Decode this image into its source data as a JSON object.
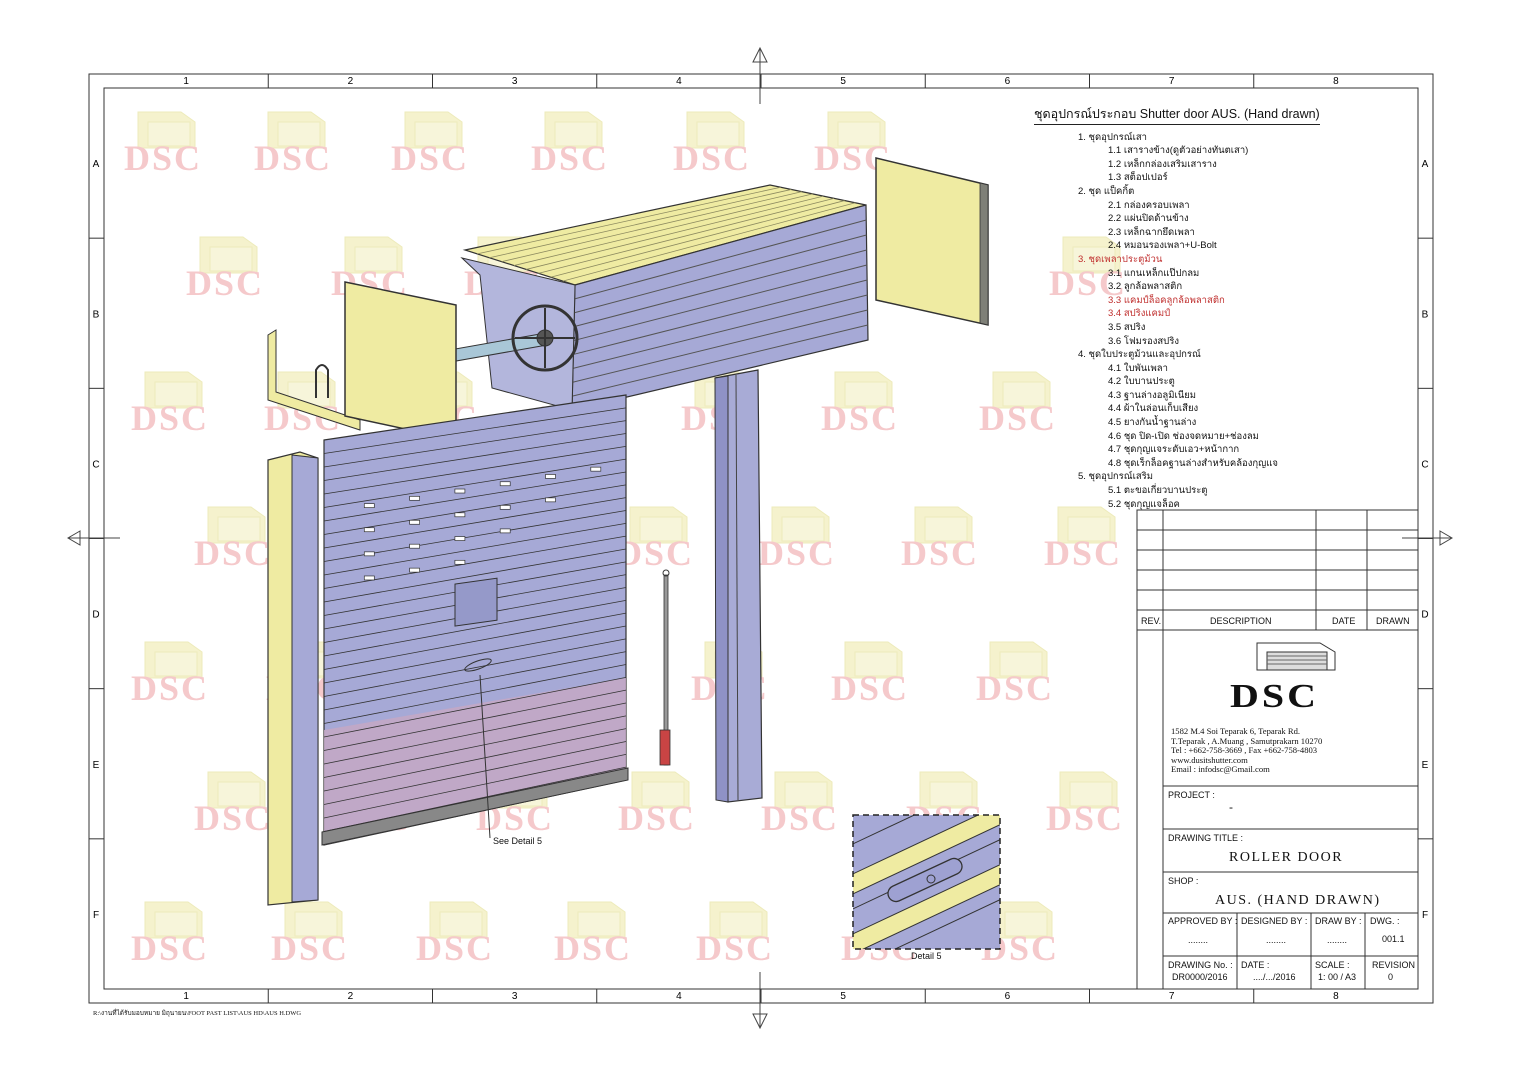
{
  "grid": {
    "columns": [
      "1",
      "2",
      "3",
      "4",
      "5",
      "6",
      "7",
      "8"
    ],
    "rows": [
      "A",
      "B",
      "C",
      "D",
      "E",
      "F"
    ]
  },
  "watermark": {
    "text": "DSC"
  },
  "parts_list": {
    "title": "ชุดอุปกรณ์ประกอบ Shutter door  AUS. (Hand drawn)",
    "items": [
      {
        "text": "1. ชุดอุปกรณ์เสา",
        "level": 0
      },
      {
        "text": "1.1 เสารางข้าง(ดูตัวอย่างทันตเสา)",
        "level": 1
      },
      {
        "text": "1.2 เหล็กกล่องเสริมเสาราง",
        "level": 1
      },
      {
        "text": "1.3 สต็อปเปอร์",
        "level": 1
      },
      {
        "text": "2. ชุด แป็คกิ้ต",
        "level": 0
      },
      {
        "text": "2.1 กล่องครอบเพลา",
        "level": 1
      },
      {
        "text": "2.2 แผ่นปิดด้านข้าง",
        "level": 1
      },
      {
        "text": "2.3 เหล็กฉากยึดเพลา",
        "level": 1
      },
      {
        "text": "2.4 หมอนรองเพลา+U-Bolt",
        "level": 1
      },
      {
        "text": "3. ชุดเพลาประตูม้วน",
        "level": 0,
        "accent": true
      },
      {
        "text": "3.1 แกนเหล็กแป๊ปกลม",
        "level": 1
      },
      {
        "text": "3.2 ลูกล้อพลาสติก",
        "level": 1
      },
      {
        "text": "3.3 แคมป์ล็อคลูกล้อพลาสติก",
        "level": 1,
        "accent": true
      },
      {
        "text": "3.4 สปริงแคมป์",
        "level": 1,
        "accent": true
      },
      {
        "text": "3.5 สปริง",
        "level": 1
      },
      {
        "text": "3.6 โฟมรองสปริง",
        "level": 1
      },
      {
        "text": "4. ชุดใบประตูม้วนและอุปกรณ์",
        "level": 0
      },
      {
        "text": "4.1 ใบพันเพลา",
        "level": 1
      },
      {
        "text": "4.2 ใบบานประตู",
        "level": 1
      },
      {
        "text": "4.3 ฐานล่างอลูมิเนียม",
        "level": 1
      },
      {
        "text": "4.4 ผ้าในล่อนเก็บเสียง",
        "level": 1
      },
      {
        "text": "4.5 ยางกันน้ำฐานล่าง",
        "level": 1
      },
      {
        "text": "4.6 ชุด ปิด-เปิด ช่องจดหมาย+ช่องลม",
        "level": 1
      },
      {
        "text": "4.7 ชุดกุญแจระดับเอว+หน้ากาก",
        "level": 1
      },
      {
        "text": "4.8 ชุดเร็กล็อคฐานล่างสำหรับคล้องกุญแจ",
        "level": 1
      },
      {
        "text": "5. ชุดอุปกรณ์เสริม",
        "level": 0
      },
      {
        "text": "5.1 ตะขอเกี่ยวบานประตู",
        "level": 1
      },
      {
        "text": "5.2 ชุดกุญแจล็อค",
        "level": 1
      }
    ]
  },
  "callouts": {
    "see_detail": "See Detail 5",
    "detail_label": "Detail 5"
  },
  "title_block": {
    "revision_headers": {
      "rev": "REV.",
      "description": "DESCRIPTION",
      "date": "DATE",
      "drawn": "DRAWN"
    },
    "company": {
      "logo_text": "DSC",
      "address_lines": [
        "1582 M.4 Soi Teparak 6, Teparak Rd.",
        "T.Teparak , A.Muang , Samutprakarn 10270",
        "Tel : +662-758-3669 , Fax +662-758-4803",
        "www.dusitshutter.com",
        "Email : infodsc@Gmail.com"
      ]
    },
    "project_label": "PROJECT :",
    "project_value": "-",
    "drawing_title_label": "DRAWING TITLE :",
    "drawing_title_value": "ROLLER DOOR",
    "shop_label": "SHOP :",
    "shop_value": "AUS. (HAND DRAWN)",
    "approved_by_label": "APPROVED  BY :",
    "approved_by_value": "........",
    "designed_by_label": "DESIGNED BY :",
    "designed_by_value": "........",
    "draw_by_label": "DRAW BY :",
    "draw_by_value": "........",
    "dwg_label": "DWG. :",
    "dwg_value": "001.1",
    "drawing_no_label": "DRAWING No. :",
    "drawing_no_value": "DR0000/2016",
    "date_label": "DATE :",
    "date_value": "..../.../2016",
    "scale_label": "SCALE :",
    "scale_value": "1: 00 / A3",
    "revision_label": "REVISION",
    "revision_value": "0"
  },
  "footer_path": "R:\\งานที่ได้รับมอบหมาย มิถุนายน\\FOOT PAST LIST\\AUS HD\\AUS H.DWG",
  "colors": {
    "cream": "#efeba2",
    "slat": "#a6a9d6",
    "slat_dark": "#8a8ec4",
    "slat_red": "#c9a2bb",
    "watermark_red": "#f4c4c6",
    "watermark_yellow": "#f4f1c8",
    "accent_red": "#c0302f"
  }
}
